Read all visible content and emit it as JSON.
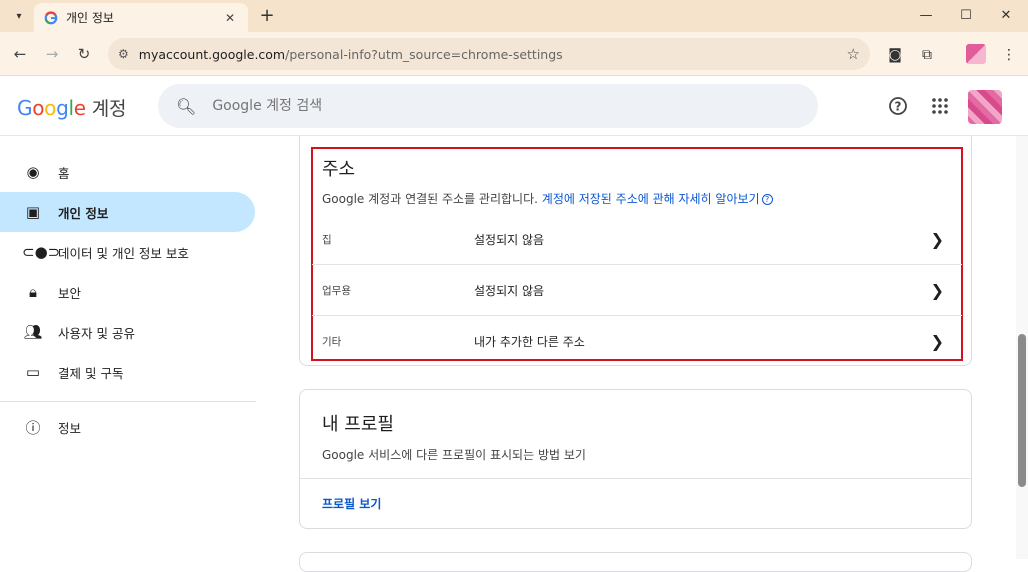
{
  "browser": {
    "tab_title": "개인 정보",
    "url_domain": "myaccount.google.com",
    "url_path": "/personal-info?utm_source=chrome-settings",
    "accent": "#f6e3cc"
  },
  "header": {
    "logo_text": "Google",
    "product": "계정",
    "search_placeholder": "Google 계정 검색"
  },
  "sidebar": {
    "items": [
      {
        "label": "홈",
        "icon": "account-circle-icon"
      },
      {
        "label": "개인 정보",
        "icon": "id-card-icon",
        "active": true
      },
      {
        "label": "데이터 및 개인 정보 보호",
        "icon": "toggle-icon"
      },
      {
        "label": "보안",
        "icon": "lock-icon"
      },
      {
        "label": "사용자 및 공유",
        "icon": "people-icon"
      },
      {
        "label": "결제 및 구독",
        "icon": "credit-card-icon"
      },
      {
        "label": "정보",
        "icon": "info-icon"
      }
    ]
  },
  "address": {
    "title": "주소",
    "desc": "Google 계정과 연결된 주소를 관리합니다.",
    "link": "계정에 저장된 주소에 관해 자세히 알아보기",
    "rows": [
      {
        "label": "집",
        "value": "설정되지 않음"
      },
      {
        "label": "업무용",
        "value": "설정되지 않음"
      },
      {
        "label": "기타",
        "value": "내가 추가한 다른 주소"
      }
    ]
  },
  "profile": {
    "title": "내 프로필",
    "desc": "Google 서비스에 다른 프로필이 표시되는 방법 보기",
    "link": "프로필 보기"
  }
}
